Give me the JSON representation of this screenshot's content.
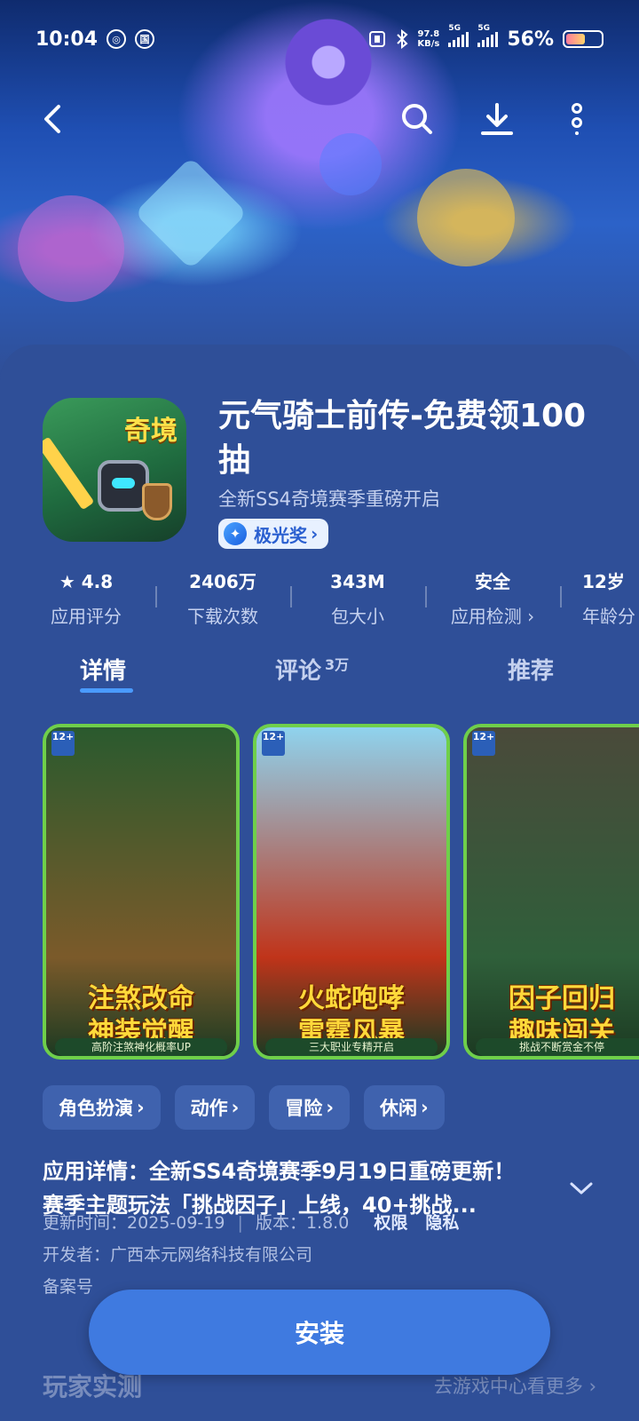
{
  "status_bar": {
    "time": "10:04",
    "net_speed_value": "97.8",
    "net_speed_unit": "KB/s",
    "sim1_label": "5G",
    "sim2_label": "5G",
    "battery_text": "56%",
    "battery_level": 0.56
  },
  "header": {
    "back_icon": "back-arrow-icon",
    "search_icon": "search-icon",
    "download_icon": "download-icon",
    "more_icon": "more-vertical-icon"
  },
  "app": {
    "title": "元气骑士前传-免费领100抽",
    "icon_badge": "奇境",
    "subtitle": "全新SS4奇境赛季重磅开启",
    "award": "极光奖"
  },
  "stats": [
    {
      "value": "4.8",
      "label": "应用评分"
    },
    {
      "value": "2406万",
      "label": "下载次数"
    },
    {
      "value": "343M",
      "label": "包大小"
    },
    {
      "value": "安全",
      "label": "应用检测"
    },
    {
      "value": "12岁",
      "label": "年龄分"
    }
  ],
  "tabs": {
    "details": "详情",
    "reviews": "评论",
    "reviews_count": "3万",
    "recommended": "推荐"
  },
  "screenshots": [
    {
      "rating_tag": "12+",
      "caption_line1": "注煞改命",
      "caption_line2": "神装觉醒",
      "footer": "高阶注煞神化概率UP",
      "colors": [
        "#2a5a2e",
        "#7b5a2a"
      ]
    },
    {
      "rating_tag": "12+",
      "caption_line1": "火蛇咆哮",
      "caption_line2": "雷霆风暴",
      "footer": "三大职业专精开启",
      "colors": [
        "#8fd3ee",
        "#c0341a"
      ]
    },
    {
      "rating_tag": "12+",
      "caption_line1": "因子回归",
      "caption_line2": "趣味闯关",
      "footer": "挑战不断赏金不停",
      "colors": [
        "#4a4a3a",
        "#2f5f3a"
      ]
    }
  ],
  "genres": [
    "角色扮演",
    "动作",
    "冒险",
    "休闲"
  ],
  "description": {
    "line1": "应用详情：全新SS4奇境赛季9月19日重磅更新！",
    "line2": "赛季主题玩法「挑战因子」上线，40+挑战..."
  },
  "meta": {
    "update_label": "更新时间：",
    "update_value": "2025-09-19",
    "version_label": "版本：",
    "version_value": "1.8.0",
    "permissions": "权限",
    "privacy": "隐私",
    "developer_label": "开发者：",
    "developer_value": "广西本元网络科技有限公司",
    "filing_label": "备案号"
  },
  "install_button": "安装",
  "bottom_section": {
    "title": "玩家实测",
    "more": "去游戏中心看更多"
  }
}
